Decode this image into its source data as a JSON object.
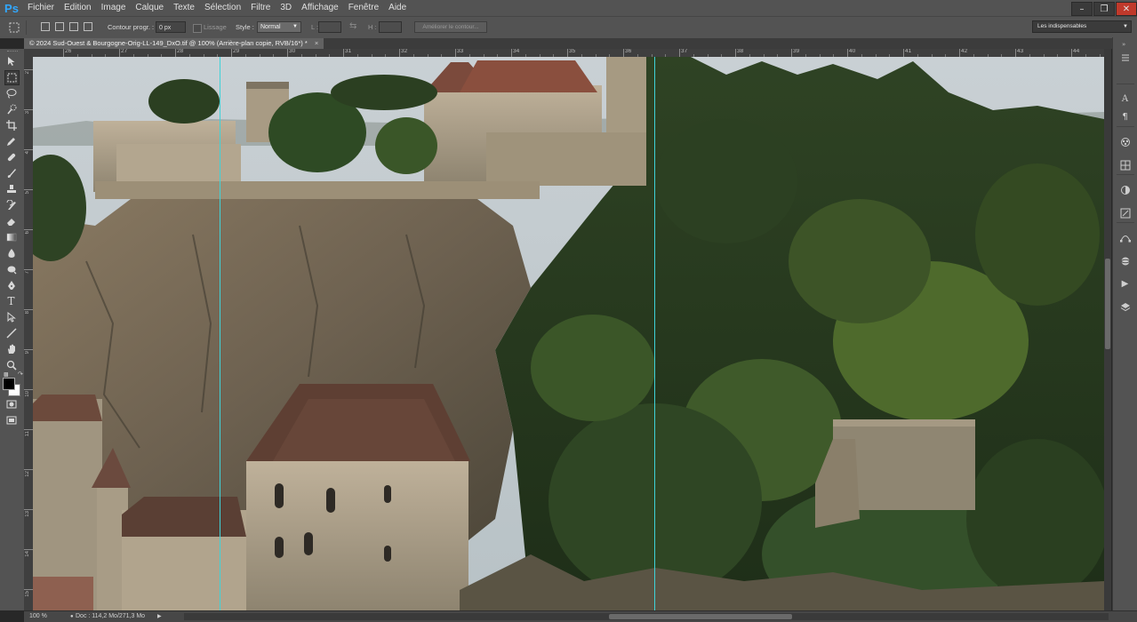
{
  "app": {
    "logo": "Ps"
  },
  "menu": [
    "Fichier",
    "Edition",
    "Image",
    "Calque",
    "Texte",
    "Sélection",
    "Filtre",
    "3D",
    "Affichage",
    "Fenêtre",
    "Aide"
  ],
  "options": {
    "feather_label": "Contour progr. :",
    "feather_value": "0 px",
    "antialias_label": "Lissage",
    "style_label": "Style :",
    "style_value": "Normal",
    "width_label": "L :",
    "height_label": "H :",
    "refine_button": "Améliorer le contour...",
    "workspace": "Les indispensables"
  },
  "document_tab": "© 2024 Sud-Ouest & Bourgogne-Orig-LL-149_DxO.tif @ 100% (Arrière-plan copie, RVB/16*) *",
  "ruler_top": [
    "26",
    "27",
    "28",
    "29",
    "30",
    "31",
    "32",
    "33",
    "34",
    "35",
    "36",
    "37",
    "38",
    "39",
    "40",
    "41",
    "42",
    "43",
    "44"
  ],
  "ruler_left": [
    "2",
    "3",
    "4",
    "5",
    "6",
    "7",
    "8",
    "9",
    "10",
    "11",
    "12",
    "13",
    "14",
    "15"
  ],
  "status": {
    "zoom": "100 %",
    "doc_info": "Doc : 114,2 Mo/271,3 Mo"
  },
  "colors": {
    "guide": "#3fd3d9",
    "ps_blue": "#31a8ff",
    "ui_panel": "#535353",
    "ui_dark": "#282828"
  },
  "photo": {
    "subject": "Rocamadour",
    "tag": "photo-canvas"
  }
}
